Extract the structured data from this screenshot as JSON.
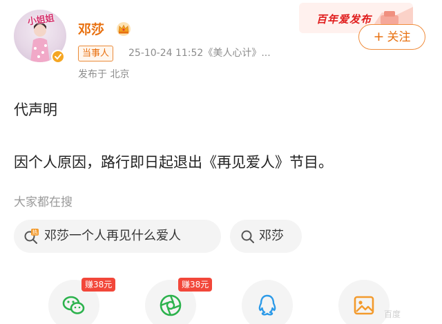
{
  "profile": {
    "avatar_caption": "小姐姐",
    "name": "邓莎",
    "role_badge": "当事人",
    "meta": "25-10-24 11:52《美人心计》...",
    "location": "发布于 北京"
  },
  "banner": {
    "text": "百年爱发布"
  },
  "follow_button": {
    "label": "关注",
    "plus": "+"
  },
  "post": {
    "line1": "代声明",
    "line2": "因个人原因，路行即日起退出《再见爱人》节目。"
  },
  "searches": {
    "heading": "大家都在搜",
    "chips": [
      {
        "label": "邓莎一个人再见什么爱人",
        "icon": "hot-search-icon"
      },
      {
        "label": "邓莎",
        "icon": "search-icon"
      }
    ]
  },
  "share": {
    "items": [
      {
        "icon": "wechat-icon",
        "reward": "赚38元"
      },
      {
        "icon": "moments-icon",
        "reward": "赚38元"
      },
      {
        "icon": "qq-icon"
      },
      {
        "icon": "image-icon"
      }
    ]
  },
  "watermark": "百度"
}
